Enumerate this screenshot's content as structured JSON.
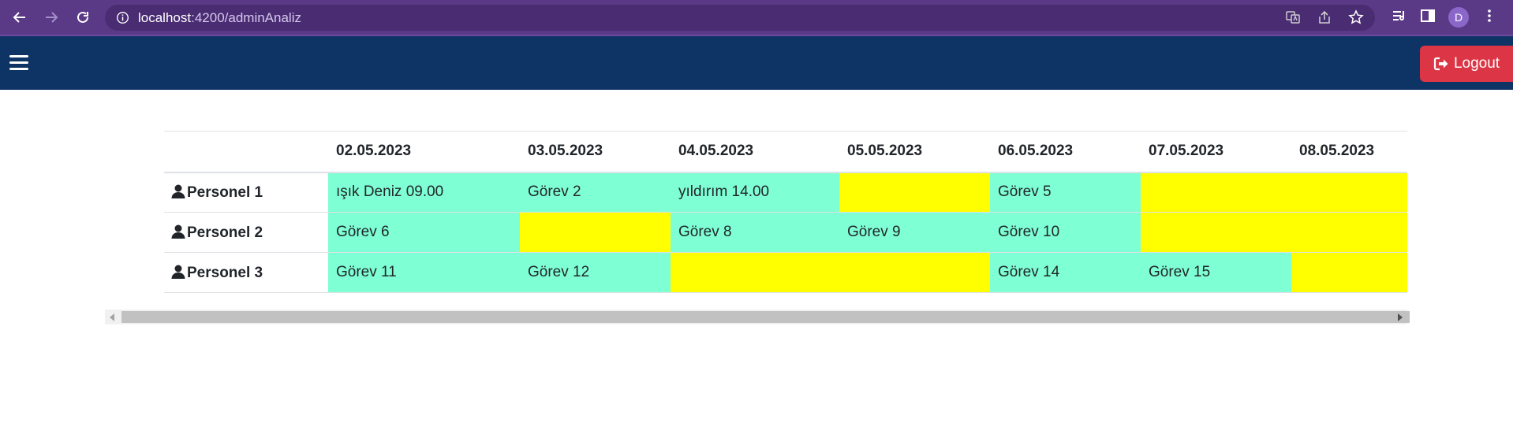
{
  "browser": {
    "url_host": "localhost",
    "url_path": ":4200/adminAnaliz",
    "profile_initial": "D"
  },
  "navbar": {
    "logout_label": "Logout"
  },
  "table": {
    "dates": [
      "02.05.2023",
      "03.05.2023",
      "04.05.2023",
      "05.05.2023",
      "06.05.2023",
      "07.05.2023",
      "08.05.2023"
    ],
    "rows": [
      {
        "name": "Personel 1",
        "cells": [
          {
            "text": "ışık Deniz 09.00",
            "status": "green"
          },
          {
            "text": "Görev 2",
            "status": "green"
          },
          {
            "text": "yıldırım 14.00",
            "status": "green"
          },
          {
            "text": "",
            "status": "yellow"
          },
          {
            "text": "Görev 5",
            "status": "green"
          },
          {
            "text": "",
            "status": "yellow"
          },
          {
            "text": "",
            "status": "yellow"
          }
        ]
      },
      {
        "name": "Personel 2",
        "cells": [
          {
            "text": "Görev 6",
            "status": "green"
          },
          {
            "text": "",
            "status": "yellow"
          },
          {
            "text": "Görev 8",
            "status": "green"
          },
          {
            "text": "Görev 9",
            "status": "green"
          },
          {
            "text": "Görev 10",
            "status": "green"
          },
          {
            "text": "",
            "status": "yellow"
          },
          {
            "text": "",
            "status": "yellow"
          }
        ]
      },
      {
        "name": "Personel 3",
        "cells": [
          {
            "text": "Görev 11",
            "status": "green"
          },
          {
            "text": "Görev 12",
            "status": "green"
          },
          {
            "text": "",
            "status": "yellow"
          },
          {
            "text": "",
            "status": "yellow"
          },
          {
            "text": "Görev 14",
            "status": "green"
          },
          {
            "text": "Görev 15",
            "status": "green"
          },
          {
            "text": "",
            "status": "yellow"
          }
        ]
      }
    ]
  },
  "colors": {
    "assigned": "#7fffd4",
    "empty": "#ffff00",
    "navbar": "#0d3464",
    "logout": "#dc3545",
    "browser": "#5a3a86"
  },
  "icons": {
    "back": "arrow-left-icon",
    "forward": "arrow-right-icon",
    "reload": "reload-icon",
    "info": "info-icon",
    "translate": "translate-icon",
    "share": "share-icon",
    "bookmark": "star-icon",
    "reading_list": "reading-list-icon",
    "side_panel": "side-panel-icon",
    "menu": "more-vert-icon",
    "hamburger": "hamburger-icon",
    "logout": "sign-out-icon",
    "user": "user-icon"
  }
}
